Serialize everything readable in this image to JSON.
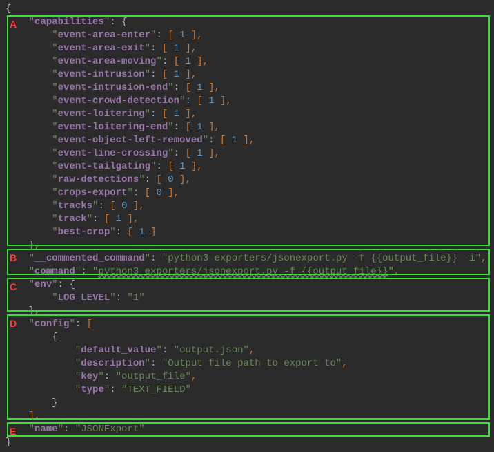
{
  "labels": {
    "A": "A",
    "B": "B",
    "C": "C",
    "D": "D",
    "E": "E"
  },
  "json": {
    "key_capabilities": "capabilities",
    "cap": [
      {
        "k": "event-area-enter",
        "v": "1"
      },
      {
        "k": "event-area-exit",
        "v": "1"
      },
      {
        "k": "event-area-moving",
        "v": "1"
      },
      {
        "k": "event-intrusion",
        "v": "1"
      },
      {
        "k": "event-intrusion-end",
        "v": "1"
      },
      {
        "k": "event-crowd-detection",
        "v": "1"
      },
      {
        "k": "event-loitering",
        "v": "1"
      },
      {
        "k": "event-loitering-end",
        "v": "1"
      },
      {
        "k": "event-object-left-removed",
        "v": "1"
      },
      {
        "k": "event-line-crossing",
        "v": "1"
      },
      {
        "k": "event-tailgating",
        "v": "1"
      },
      {
        "k": "raw-detections",
        "v": "0"
      },
      {
        "k": "crops-export",
        "v": "0"
      },
      {
        "k": "tracks",
        "v": "0"
      },
      {
        "k": "track",
        "v": "1"
      },
      {
        "k": "best-crop",
        "v": "1"
      }
    ],
    "key_commented_command": "__commented_command",
    "val_commented_command": "python3 exporters/jsonexport.py -f {{output_file}} -i",
    "key_command": "command",
    "val_command": "python3 exporters/jsonexport.py -f {{output_file}}",
    "key_env": "env",
    "env_k": "LOG_LEVEL",
    "env_v": "1",
    "key_config": "config",
    "cfg_default_value_k": "default_value",
    "cfg_default_value_v": "output.json",
    "cfg_description_k": "description",
    "cfg_description_v": "Output file path to export to",
    "cfg_key_k": "key",
    "cfg_key_v": "output_file",
    "cfg_type_k": "type",
    "cfg_type_v": "TEXT_FIELD",
    "key_name": "name",
    "val_name": "JSONExport"
  }
}
